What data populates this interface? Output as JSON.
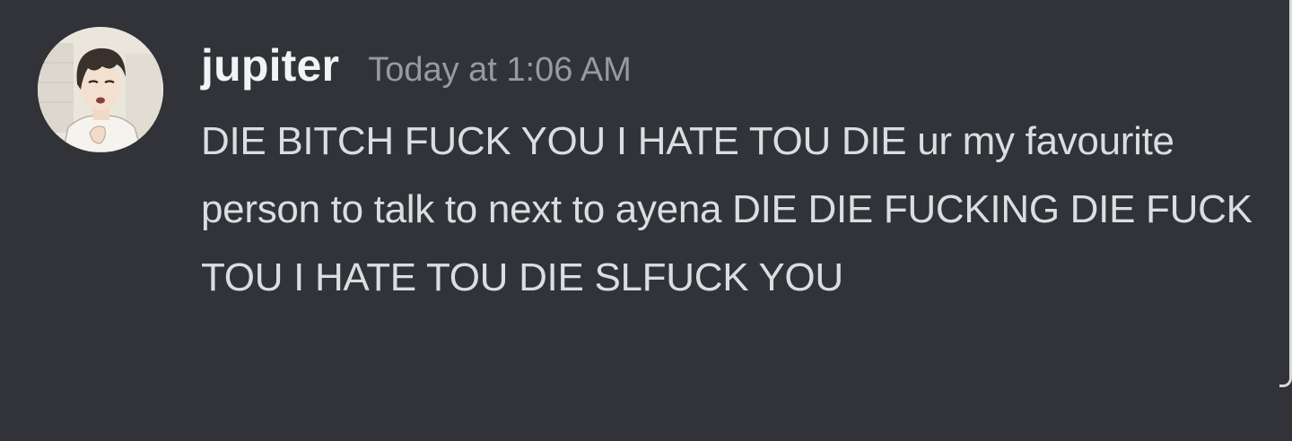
{
  "message": {
    "author": {
      "username": "jupiter",
      "avatar_icon": "anime-character-avatar-icon"
    },
    "timestamp": "Today at 1:06 AM",
    "content": "DIE BITCH FUCK YOU I HATE TOU DIE ur my favourite person to talk to next to ayena DIE DIE FUCKING DIE FUCK TOU I HATE TOU DIE SLFUCK YOU"
  },
  "colors": {
    "background": "#313338",
    "username": "#f2f3f5",
    "timestamp": "#949ba4",
    "message_text": "#dbdee1"
  }
}
